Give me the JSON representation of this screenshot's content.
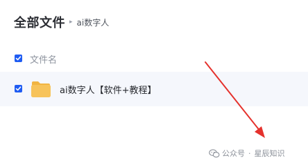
{
  "header": {
    "title": "全部文件",
    "separator": "▸",
    "current_folder": "ai数字人"
  },
  "list_header": {
    "column_name": "文件名",
    "select_all_checked": true
  },
  "files": [
    {
      "name": "ai数字人【软件+教程】",
      "type": "folder",
      "icon": "folder-icon",
      "checked": true
    }
  ],
  "watermark": {
    "icon": "wechat-icon",
    "source": "公众号",
    "dot": "·",
    "account": "星辰知识"
  },
  "colors": {
    "accent": "#1f5cf2",
    "folder": "#f7c35a",
    "row_highlight": "#f5f7fc",
    "arrow": "#e5322d"
  }
}
